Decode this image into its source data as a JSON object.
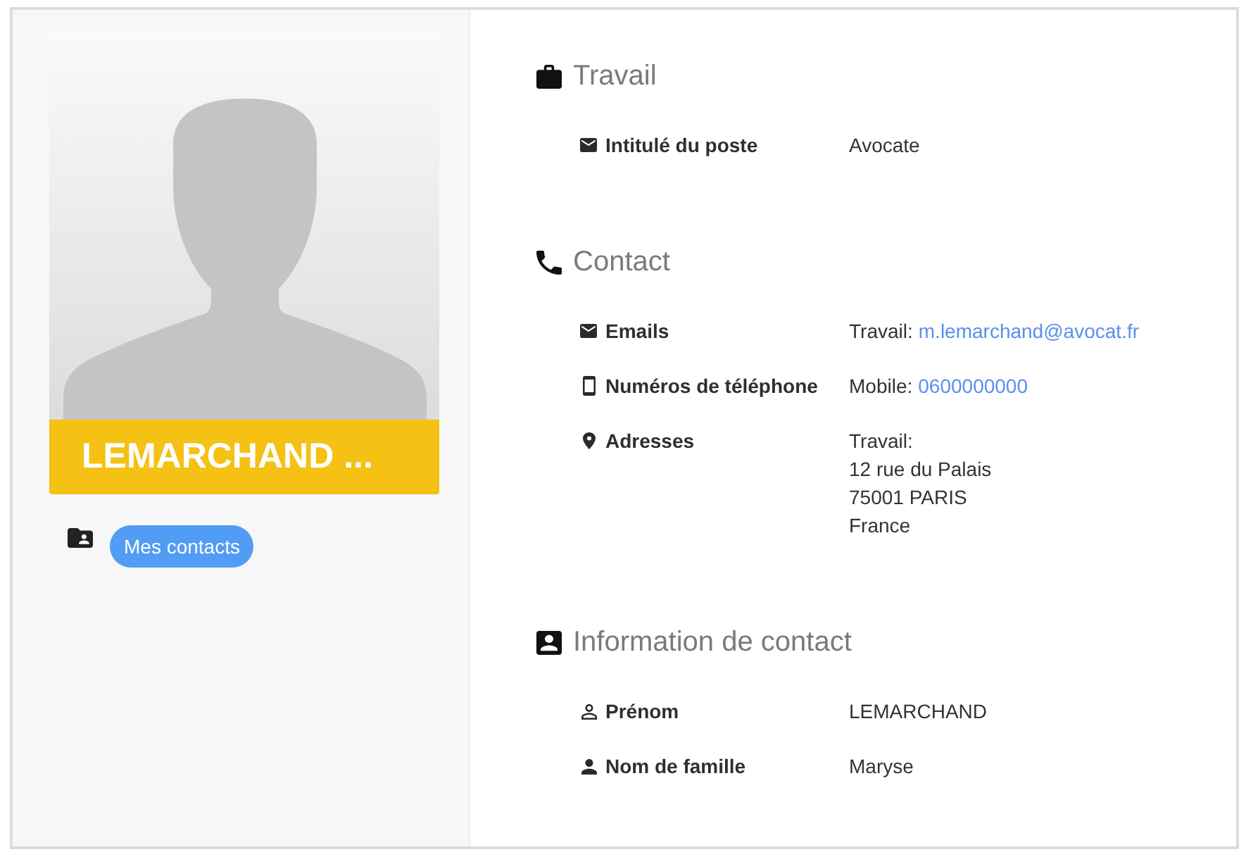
{
  "profile": {
    "name": "LEMARCHAND ...",
    "group_tag": "Mes contacts"
  },
  "sections": [
    {
      "kind": "work",
      "title": "Travail",
      "fields": [
        {
          "kind": "job",
          "label": "Intitulé du poste",
          "value": "Avocate"
        }
      ]
    },
    {
      "kind": "contact",
      "title": "Contact",
      "fields": [
        {
          "kind": "email",
          "label": "Emails",
          "prefix": "Travail:",
          "link": "m.lemarchand@avocat.fr"
        },
        {
          "kind": "phone",
          "label": "Numéros de téléphone",
          "prefix": "Mobile:",
          "link": "0600000000"
        },
        {
          "kind": "address",
          "label": "Adresses",
          "lines": [
            "Travail:",
            "12 rue du Palais",
            "75001 PARIS",
            "France"
          ]
        }
      ]
    },
    {
      "kind": "identity",
      "title": "Information de contact",
      "fields": [
        {
          "kind": "first_name",
          "label": "Prénom",
          "value": "LEMARCHAND"
        },
        {
          "kind": "last_name",
          "label": "Nom de famille",
          "value": "Maryse"
        }
      ]
    }
  ]
}
